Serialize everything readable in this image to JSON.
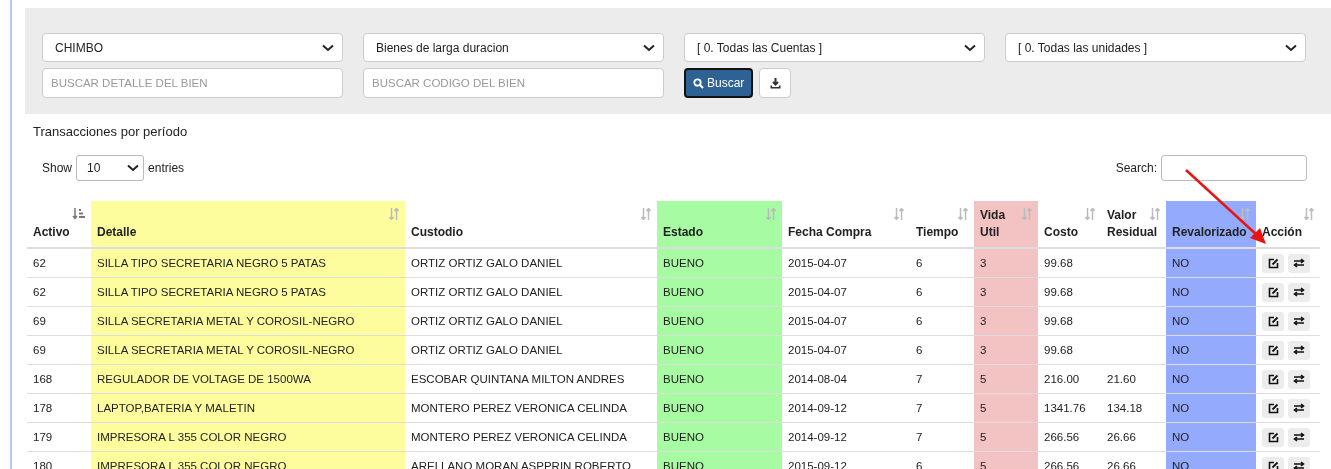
{
  "filters": {
    "selects": [
      "CHIMBO",
      "Bienes de larga duracion",
      "[ 0. Todas las Cuentas ]",
      "[ 0. Todas las unidades ]"
    ],
    "fields": [
      {
        "placeholder": "BUSCAR DETALLE DEL BIEN"
      },
      {
        "placeholder": "BUSCAR CODIGO DEL BIEN"
      }
    ],
    "search_button": "Buscar"
  },
  "section_title": "Transacciones por período",
  "length": {
    "before": "Show",
    "value": "10",
    "after": "entries"
  },
  "search": {
    "label": "Search:"
  },
  "table": {
    "columns": [
      {
        "label": "Activo",
        "sorted": true
      },
      {
        "label": "Detalle",
        "sorted": false,
        "color": "#fdfd9e"
      },
      {
        "label": "Custodio",
        "sorted": false
      },
      {
        "label": "Estado",
        "sorted": false,
        "color": "#a6fba3"
      },
      {
        "label": "Fecha Compra",
        "sorted": false
      },
      {
        "label": "Tiempo",
        "sorted": false
      },
      {
        "label": "Vida Util",
        "sorted": false,
        "color": "#f3c2c2"
      },
      {
        "label": "Costo",
        "sorted": false
      },
      {
        "label": "Valor Residual",
        "sorted": false
      },
      {
        "label": "Revalorizado",
        "sorted": false,
        "color": "#94abfd"
      },
      {
        "label": "Acción",
        "sorted": false
      }
    ],
    "rows": [
      [
        "62",
        "SILLA TIPO SECRETARIA NEGRO 5 PATAS",
        "ORTIZ ORTIZ GALO DANIEL",
        "BUENO",
        "2015-04-07",
        "6",
        "3",
        "99.68",
        "",
        "NO"
      ],
      [
        "62",
        "SILLA TIPO SECRETARIA NEGRO 5 PATAS",
        "ORTIZ ORTIZ GALO DANIEL",
        "BUENO",
        "2015-04-07",
        "6",
        "3",
        "99.68",
        "",
        "NO"
      ],
      [
        "69",
        "SILLA SECRETARIA METAL Y COROSIL-NEGRO",
        "ORTIZ ORTIZ GALO DANIEL",
        "BUENO",
        "2015-04-07",
        "6",
        "3",
        "99.68",
        "",
        "NO"
      ],
      [
        "69",
        "SILLA SECRETARIA METAL Y COROSIL-NEGRO",
        "ORTIZ ORTIZ GALO DANIEL",
        "BUENO",
        "2015-04-07",
        "6",
        "3",
        "99.68",
        "",
        "NO"
      ],
      [
        "168",
        "REGULADOR DE VOLTAGE DE 1500WA",
        "ESCOBAR QUINTANA MILTON ANDRES",
        "BUENO",
        "2014-08-04",
        "7",
        "5",
        "216.00",
        "21.60",
        "NO"
      ],
      [
        "178",
        "LAPTOP,BATERIA Y MALETIN",
        "MONTERO PEREZ VERONICA CELINDA",
        "BUENO",
        "2014-09-12",
        "7",
        "5",
        "1341.76",
        "134.18",
        "NO"
      ],
      [
        "179",
        "IMPRESORA L 355 COLOR NEGRO",
        "MONTERO PEREZ VERONICA CELINDA",
        "BUENO",
        "2014-09-12",
        "7",
        "5",
        "266.56",
        "26.66",
        "NO"
      ],
      [
        "180",
        "IMPRESORA L 355 COLOR NEGRO",
        "ARELLANO MORAN ASPPRIN ROBERTO",
        "BUENO",
        "2015-09-12",
        "6",
        "5",
        "266.56",
        "26.66",
        "NO"
      ]
    ]
  }
}
